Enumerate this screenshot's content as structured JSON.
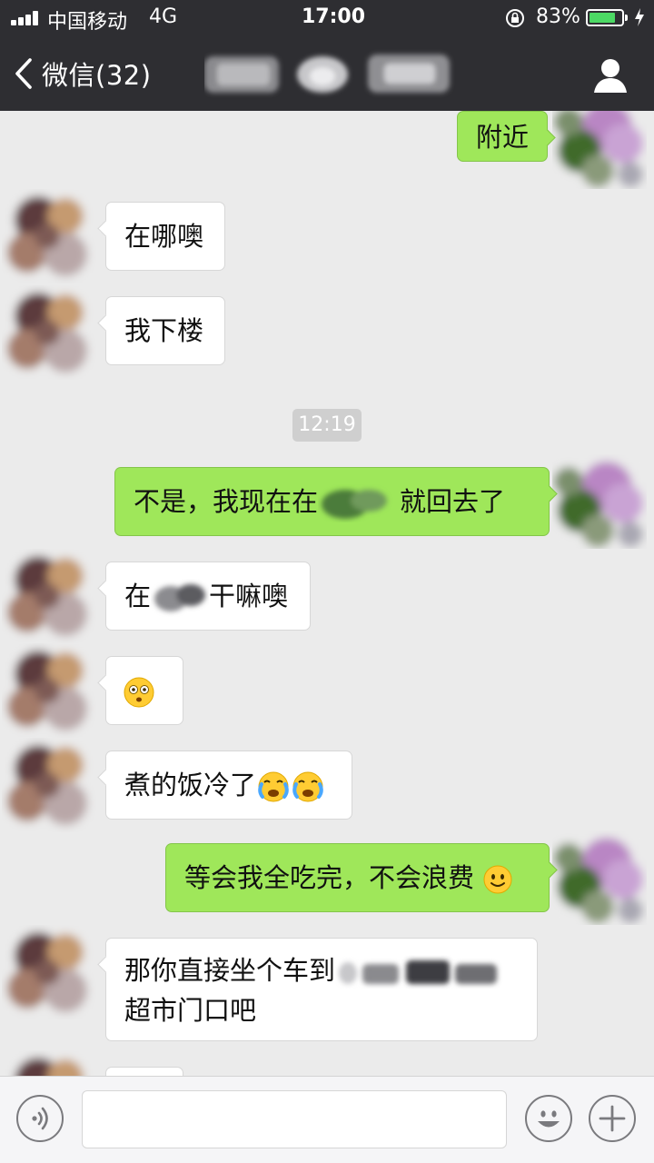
{
  "status_bar": {
    "carrier": "中国移动",
    "network": "4G",
    "time": "17:00",
    "battery_percent": "83%",
    "battery_level": 0.83,
    "battery_color": "#4cd964"
  },
  "nav": {
    "back_label": "微信(32)",
    "back_icon": "chevron-left-icon",
    "profile_icon": "person-icon"
  },
  "messages": {
    "m1": {
      "sender": "me",
      "text": "附近"
    },
    "m2": {
      "sender": "them",
      "text": "在哪噢"
    },
    "m3": {
      "sender": "them",
      "text": "我下楼"
    },
    "timestamp": "12:19",
    "m4": {
      "sender": "me",
      "text_before": "不是，我现在在",
      "text_after": "就回去了"
    },
    "m5": {
      "sender": "them",
      "text_before": "在",
      "text_after": "干嘛噢"
    },
    "m6": {
      "sender": "them",
      "emoji": "flushed-face-icon"
    },
    "m7": {
      "sender": "them",
      "text": "煮的饭冷了",
      "emojis": [
        "crying-face-icon",
        "crying-face-icon"
      ]
    },
    "m8": {
      "sender": "me",
      "text": "等会我全吃完，不会浪费",
      "emoji": "smiling-face-icon"
    },
    "m9": {
      "sender": "them",
      "line1": "那你直接坐个车到",
      "line2": "超市门口吧"
    }
  },
  "input_bar": {
    "input_value": "",
    "voice_icon": "voice-icon",
    "emoji_icon": "smiley-icon",
    "plus_icon": "plus-icon"
  },
  "colors": {
    "header": "#2e2e32",
    "chat_background": "#ebebeb",
    "my_bubble": "#9fe75a",
    "their_bubble": "#ffffff"
  }
}
